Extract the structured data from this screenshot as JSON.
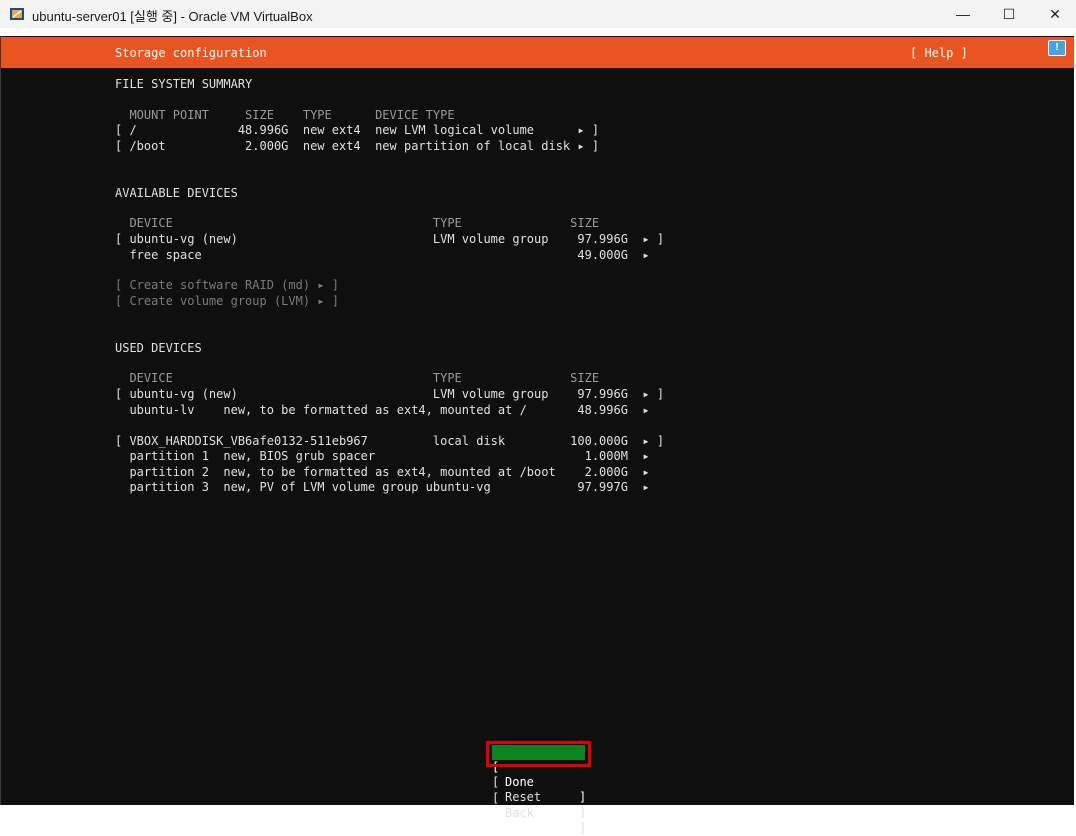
{
  "window": {
    "title": "ubuntu-server01 [실행 중] - Oracle VM VirtualBox",
    "minimize": "—",
    "maximize": "☐",
    "close": "✕"
  },
  "header": {
    "title": "Storage configuration",
    "help": "[ Help ]",
    "vbox_icon": "!"
  },
  "fs_summary": {
    "heading": "FILE SYSTEM SUMMARY",
    "columns": "  MOUNT POINT     SIZE    TYPE      DEVICE TYPE",
    "rows": [
      "[ /              48.996G  new ext4  new LVM logical volume      ▸ ]",
      "[ /boot           2.000G  new ext4  new partition of local disk ▸ ]"
    ]
  },
  "available": {
    "heading": "AVAILABLE DEVICES",
    "columns": "  DEVICE                                    TYPE               SIZE",
    "rows": [
      "[ ubuntu-vg (new)                           LVM volume group    97.996G  ▸ ]",
      "  free space                                                    49.000G  ▸"
    ],
    "actions": [
      "[ Create software RAID (md) ▸ ]",
      "[ Create volume group (LVM) ▸ ]"
    ]
  },
  "used": {
    "heading": "USED DEVICES",
    "columns": "  DEVICE                                    TYPE               SIZE",
    "rows": [
      "[ ubuntu-vg (new)                           LVM volume group    97.996G  ▸ ]",
      "  ubuntu-lv    new, to be formatted as ext4, mounted at /       48.996G  ▸",
      "",
      "[ VBOX_HARDDISK_VB6afe0132-511eb967         local disk         100.000G  ▸ ]",
      "  partition 1  new, BIOS grub spacer                             1.000M  ▸",
      "  partition 2  new, to be formatted as ext4, mounted at /boot    2.000G  ▸",
      "  partition 3  new, PV of LVM volume group ubuntu-vg            97.997G  ▸"
    ]
  },
  "buttons": {
    "left_bracket": "[",
    "right_bracket": "]",
    "done": "Done",
    "reset": "Reset",
    "back": "Back"
  }
}
